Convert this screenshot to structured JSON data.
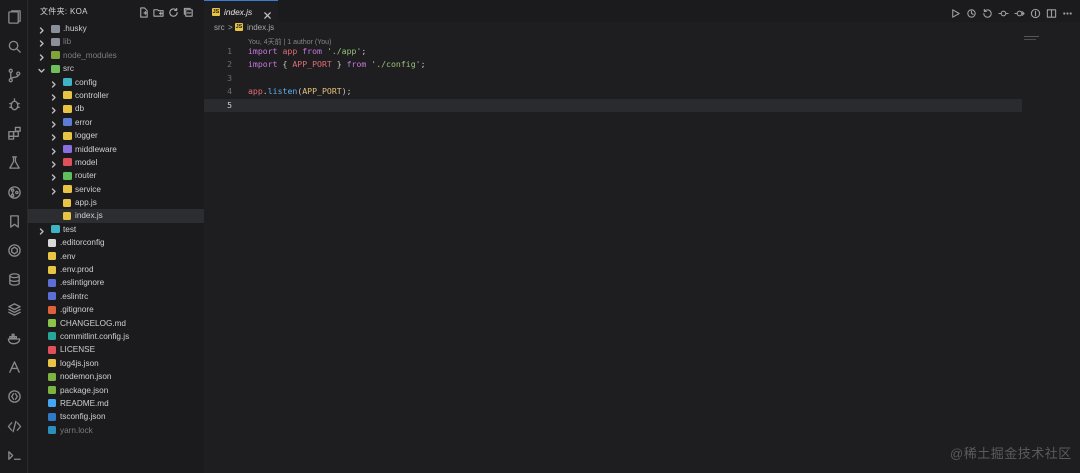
{
  "sidebar": {
    "title": "文件夹: KOA",
    "items": [
      {
        "label": ".husky",
        "kind": "folder",
        "depth": 0,
        "expanded": false,
        "color": "#8a8f99"
      },
      {
        "label": "lib",
        "kind": "folder",
        "depth": 0,
        "expanded": false,
        "color": "#8a8f99",
        "dim": true
      },
      {
        "label": "node_modules",
        "kind": "folder",
        "depth": 0,
        "expanded": false,
        "color": "#7fa33a",
        "dim": true
      },
      {
        "label": "src",
        "kind": "folder",
        "depth": 0,
        "expanded": true,
        "color": "#6fbf5a"
      },
      {
        "label": "config",
        "kind": "folder",
        "depth": 1,
        "expanded": false,
        "color": "#3eb3c4"
      },
      {
        "label": "controller",
        "kind": "folder",
        "depth": 1,
        "expanded": false,
        "color": "#e8c445"
      },
      {
        "label": "db",
        "kind": "folder",
        "depth": 1,
        "expanded": false,
        "color": "#e8c445"
      },
      {
        "label": "error",
        "kind": "folder",
        "depth": 1,
        "expanded": false,
        "color": "#5c7cd6"
      },
      {
        "label": "logger",
        "kind": "folder",
        "depth": 1,
        "expanded": false,
        "color": "#e8c445"
      },
      {
        "label": "middleware",
        "kind": "folder",
        "depth": 1,
        "expanded": false,
        "color": "#8a6fe0"
      },
      {
        "label": "model",
        "kind": "folder",
        "depth": 1,
        "expanded": false,
        "color": "#e0505a"
      },
      {
        "label": "router",
        "kind": "folder",
        "depth": 1,
        "expanded": false,
        "color": "#5fbf5a"
      },
      {
        "label": "service",
        "kind": "folder",
        "depth": 1,
        "expanded": false,
        "color": "#e8c445"
      },
      {
        "label": "app.js",
        "kind": "file",
        "depth": 1,
        "color": "#e8c445",
        "glyph": "JS"
      },
      {
        "label": "index.js",
        "kind": "file",
        "depth": 1,
        "color": "#e8c445",
        "glyph": "JS",
        "selected": true
      },
      {
        "label": "test",
        "kind": "folder",
        "depth": 0,
        "expanded": false,
        "color": "#3eb3c4"
      },
      {
        "label": ".editorconfig",
        "kind": "file",
        "depth": 0,
        "color": "#d8d8d8",
        "glyph": "✎"
      },
      {
        "label": ".env",
        "kind": "file",
        "depth": 0,
        "color": "#e8c445",
        "glyph": "#"
      },
      {
        "label": ".env.prod",
        "kind": "file",
        "depth": 0,
        "color": "#e8c445",
        "glyph": "#"
      },
      {
        "label": ".eslintignore",
        "kind": "file",
        "depth": 0,
        "color": "#5c6fd6",
        "glyph": "●"
      },
      {
        "label": ".eslintrc",
        "kind": "file",
        "depth": 0,
        "color": "#5c6fd6",
        "glyph": "●"
      },
      {
        "label": ".gitignore",
        "kind": "file",
        "depth": 0,
        "color": "#e0603a",
        "glyph": "◆"
      },
      {
        "label": "CHANGELOG.md",
        "kind": "file",
        "depth": 0,
        "color": "#8bc34a",
        "glyph": "↺"
      },
      {
        "label": "commitlint.config.js",
        "kind": "file",
        "depth": 0,
        "color": "#26a69a",
        "glyph": "⚙"
      },
      {
        "label": "LICENSE",
        "kind": "file",
        "depth": 0,
        "color": "#e0505a",
        "glyph": "≡"
      },
      {
        "label": "log4js.json",
        "kind": "file",
        "depth": 0,
        "color": "#e8c445",
        "glyph": "{}"
      },
      {
        "label": "nodemon.json",
        "kind": "file",
        "depth": 0,
        "color": "#7cb342",
        "glyph": "⬢"
      },
      {
        "label": "package.json",
        "kind": "file",
        "depth": 0,
        "color": "#7cb342",
        "glyph": "⬢"
      },
      {
        "label": "README.md",
        "kind": "file",
        "depth": 0,
        "color": "#42a5f5",
        "glyph": "i"
      },
      {
        "label": "tsconfig.json",
        "kind": "file",
        "depth": 0,
        "color": "#3178c6",
        "glyph": "TS"
      },
      {
        "label": "yarn.lock",
        "kind": "file",
        "depth": 0,
        "color": "#2c8ebb",
        "glyph": "y",
        "dim": true
      }
    ]
  },
  "tab": {
    "label": "index.js"
  },
  "breadcrumb": {
    "folder": "src",
    "separator": ">",
    "file": "index.js"
  },
  "codelens": "You, 4天前 | 1 author (You)",
  "editor": {
    "lines": [
      {
        "num": "1",
        "tokens": [
          {
            "t": "import",
            "c": "kw"
          },
          {
            "t": " app ",
            "c": "id"
          },
          {
            "t": "from",
            "c": "kw"
          },
          {
            "t": " ",
            "c": "punc"
          },
          {
            "t": "'./app'",
            "c": "str"
          },
          {
            "t": ";",
            "c": "punc"
          }
        ]
      },
      {
        "num": "2",
        "tokens": [
          {
            "t": "import",
            "c": "kw"
          },
          {
            "t": " { ",
            "c": "punc"
          },
          {
            "t": "APP_PORT",
            "c": "id"
          },
          {
            "t": " } ",
            "c": "punc"
          },
          {
            "t": "from",
            "c": "kw"
          },
          {
            "t": " ",
            "c": "punc"
          },
          {
            "t": "'./config'",
            "c": "str"
          },
          {
            "t": ";",
            "c": "punc"
          }
        ]
      },
      {
        "num": "3",
        "tokens": []
      },
      {
        "num": "4",
        "tokens": [
          {
            "t": "app",
            "c": "id"
          },
          {
            "t": ".",
            "c": "punc"
          },
          {
            "t": "listen",
            "c": "fn"
          },
          {
            "t": "(",
            "c": "punc"
          },
          {
            "t": "APP_PORT",
            "c": "const"
          },
          {
            "t": ");",
            "c": "punc"
          }
        ]
      },
      {
        "num": "5",
        "tokens": [],
        "current": true
      }
    ]
  },
  "watermark": "@稀土掘金技术社区",
  "icons": {
    "activity": [
      "explorer-icon",
      "search-icon",
      "source-control-icon",
      "debug-icon",
      "extensions-icon",
      "testing-icon",
      "git-graph-icon",
      "bookmarks-icon",
      "chatgpt-icon",
      "database-icon",
      "layers-icon",
      "docker-icon",
      "git-lens-icon",
      "remote-icon",
      "code-icon",
      "terminal-icon"
    ],
    "editor_actions": [
      "run-icon",
      "timeline-icon",
      "go-back-icon",
      "go-prev-icon",
      "go-forward-icon",
      "info-icon",
      "split-editor-icon",
      "more-icon"
    ]
  }
}
